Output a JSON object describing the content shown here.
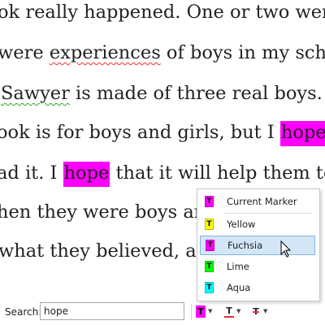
{
  "document": {
    "line1": "ok really happened. One or two were m",
    "line2_a": " were ",
    "line2_b": "experiences",
    "line2_c": " of boys in my schoo",
    "line3_a": "Sawyer",
    "line3_b": " is made of three real boys.",
    "line4_a": "ook is for boys and girls, but I ",
    "line4_hl": "hope",
    "line4_b": " th",
    "line5_a": "ad it. I ",
    "line5_hl": "hope",
    "line5_b": " that it will help them to re",
    "line6": "hen they were boys and g",
    "line7": " what they believed, ar",
    "highlight_color": "#ff00ff"
  },
  "find_bar": {
    "label": "Search:",
    "value": "hope",
    "highlighter_glyph": "T",
    "font_color_glyph": "T",
    "strike_glyph": "T"
  },
  "marker_menu": {
    "items": [
      {
        "label": "Current Marker",
        "color": "#ff00ff"
      },
      {
        "label": "Yellow",
        "color": "#ffff00"
      },
      {
        "label": "Fuchsia",
        "color": "#ff00ff",
        "selected": true
      },
      {
        "label": "Lime",
        "color": "#00ff00"
      },
      {
        "label": "Aqua",
        "color": "#00ffff"
      }
    ]
  }
}
